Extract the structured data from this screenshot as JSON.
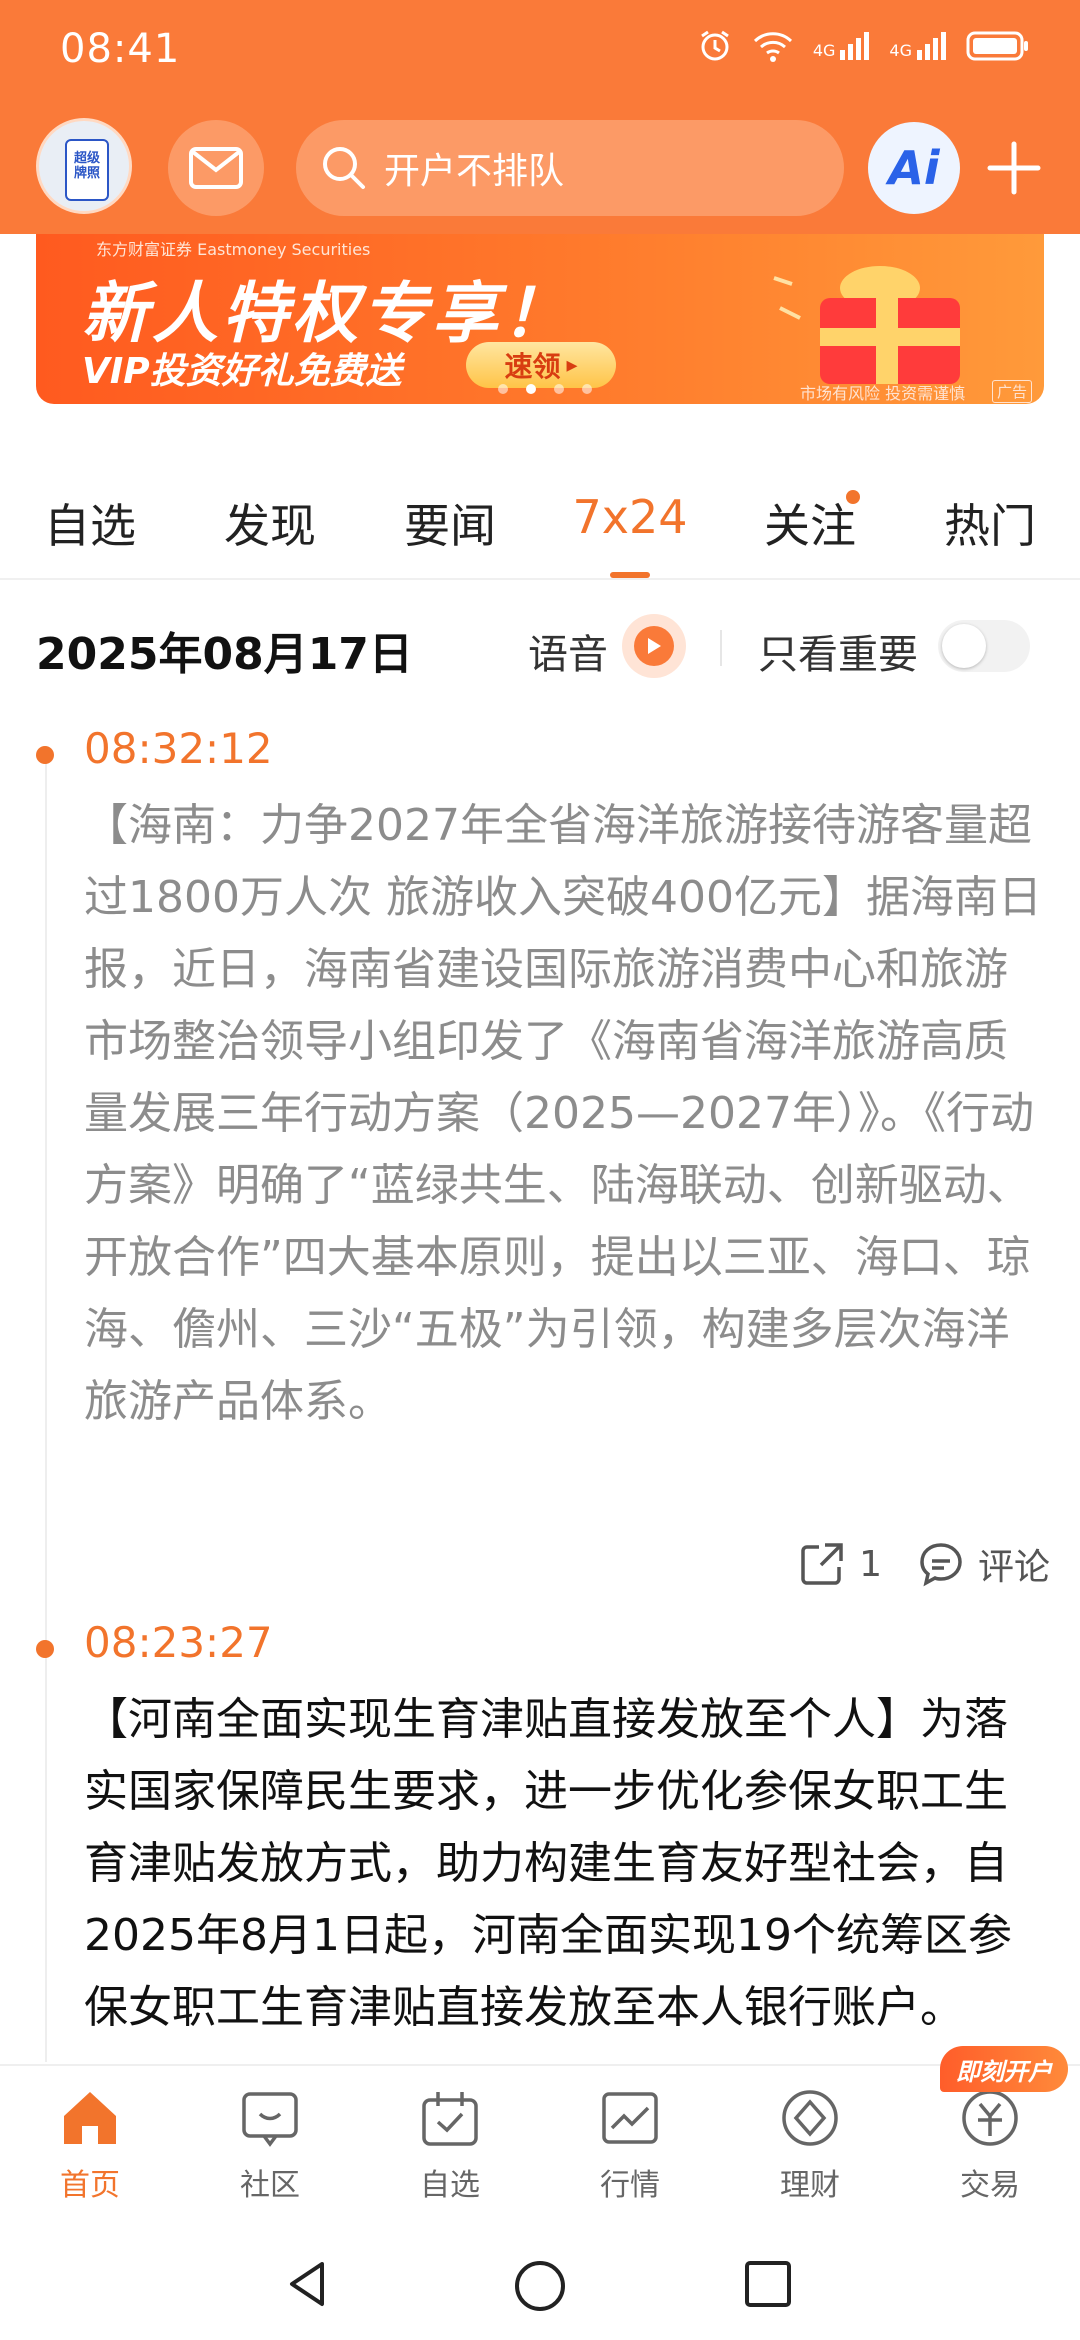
{
  "status_bar": {
    "time": "08:41",
    "signal_1": "4G",
    "signal_2": "4G"
  },
  "header": {
    "avatar_text": "超级牌照",
    "search_placeholder": "开户不排队",
    "ai_label": "Ai"
  },
  "banner": {
    "brand": "东方财富证券 Eastmoney Securities",
    "title": "新人特权专享！",
    "subtitle": "VIP投资好礼免费送",
    "cta": "速领",
    "risk_note": "市场有风险 投资需谨慎",
    "ad_tag": "广告",
    "active_slide": 2
  },
  "tabs": [
    {
      "label": "自选"
    },
    {
      "label": "发现"
    },
    {
      "label": "要闻"
    },
    {
      "label": "7x24",
      "active": true
    },
    {
      "label": "关注",
      "dot": true
    },
    {
      "label": "热门"
    }
  ],
  "date_row": {
    "date": "2025年08月17日",
    "voice_label": "语音",
    "important_only_label": "只看重要",
    "important_only_on": false
  },
  "news": [
    {
      "time": "08:32:12",
      "content": "【海南：力争2027年全省海洋旅游接待游客量超过1800万人次 旅游收入突破400亿元】据海南日报，近日，海南省建设国际旅游消费中心和旅游市场整治领导小组印发了《海南省海洋旅游高质量发展三年行动方案（2025—2027年）》。《行动方案》明确了“蓝绿共生、陆海联动、创新驱动、开放合作”四大基本原则，提出以三亚、海口、琼海、儋州、三沙“五极”为引领，构建多层次海洋旅游产品体系。",
      "share_count": "1",
      "comment_label": "评论",
      "read": true
    },
    {
      "time": "08:23:27",
      "content": "【河南全面实现生育津贴直接发放至个人】为落实国家保障民生要求，进一步优化参保女职工生育津贴发放方式，助力构建生育友好型社会，自2025年8月1日起，河南全面实现19个统筹区参保女职工生育津贴直接发放至本人银行账户。",
      "read": false
    }
  ],
  "bottom_nav": {
    "items": [
      {
        "label": "首页",
        "icon": "home-icon",
        "active": true
      },
      {
        "label": "社区",
        "icon": "community-icon"
      },
      {
        "label": "自选",
        "icon": "watchlist-icon"
      },
      {
        "label": "行情",
        "icon": "market-icon"
      },
      {
        "label": "理财",
        "icon": "wealth-icon"
      },
      {
        "label": "交易",
        "icon": "trade-icon"
      }
    ],
    "badge": "即刻开户"
  },
  "colors": {
    "accent": "#fa7a39",
    "active_text": "#f2742c"
  }
}
